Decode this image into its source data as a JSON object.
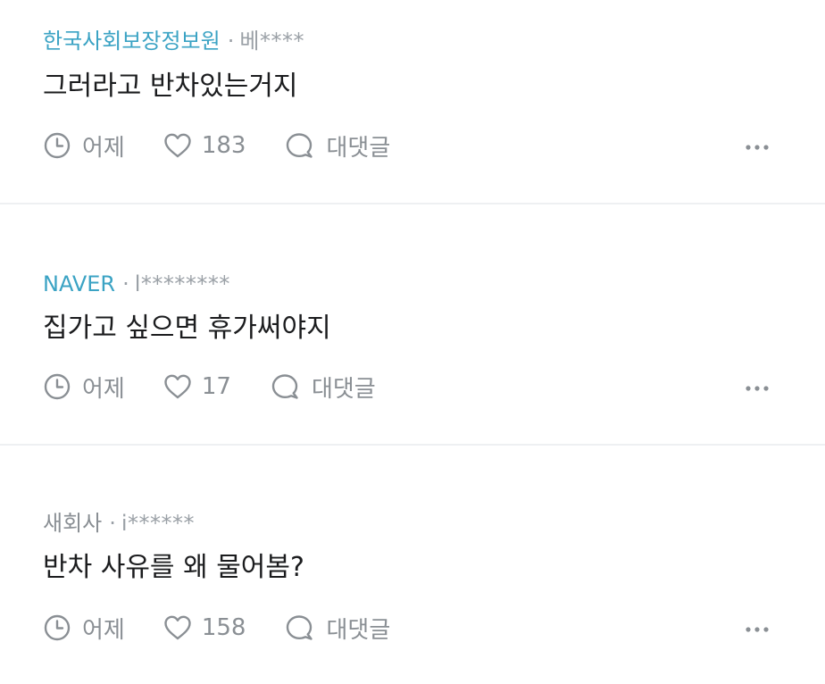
{
  "comments": [
    {
      "company": "한국사회보장정보원",
      "separator": "·",
      "user": "베****",
      "text": "그러라고 반차있는거지",
      "time": "어제",
      "likes": "183",
      "reply_label": "대댓글"
    },
    {
      "company": "NAVER",
      "separator": "·",
      "user": "l********",
      "text": "집가고 싶으면 휴가써야지",
      "time": "어제",
      "likes": "17",
      "reply_label": "대댓글"
    },
    {
      "company": "새회사",
      "separator": "·",
      "user": "i******",
      "text": "반차 사유를 왜 물어봄?",
      "time": "어제",
      "likes": "158",
      "reply_label": "대댓글"
    }
  ],
  "colors": {
    "company_link": "#3ba3c4",
    "company_plain": "#8a8f94",
    "meta_gray": "#9aa0a6",
    "body_text": "#1b1c1e",
    "divider": "#eef0f2"
  },
  "icons": {
    "time": "clock-icon",
    "like": "heart-icon",
    "reply": "speech-bubble-icon",
    "more": "more-dots-icon"
  }
}
